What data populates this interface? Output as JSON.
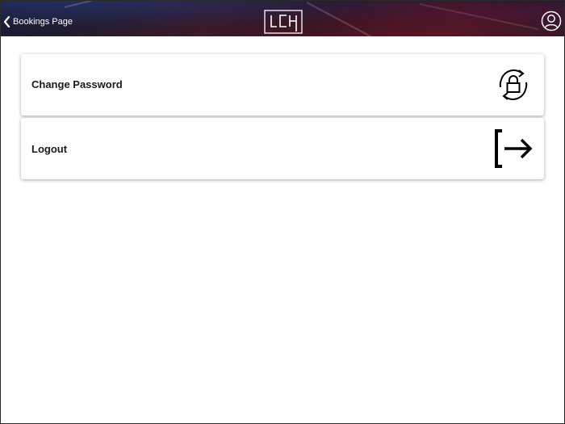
{
  "header": {
    "back_label": "Bookings Page",
    "logo_text": "LCH",
    "logo_icon": "lch-logo",
    "profile_icon": "user-circle-icon"
  },
  "menu": {
    "items": [
      {
        "label": "Change Password",
        "icon": "lock-refresh-icon"
      },
      {
        "label": "Logout",
        "icon": "logout-icon"
      }
    ]
  },
  "colors": {
    "header_background": "#241a28",
    "card_background": "#ffffff",
    "text": "#1a1a1a",
    "icon": "#000000"
  }
}
